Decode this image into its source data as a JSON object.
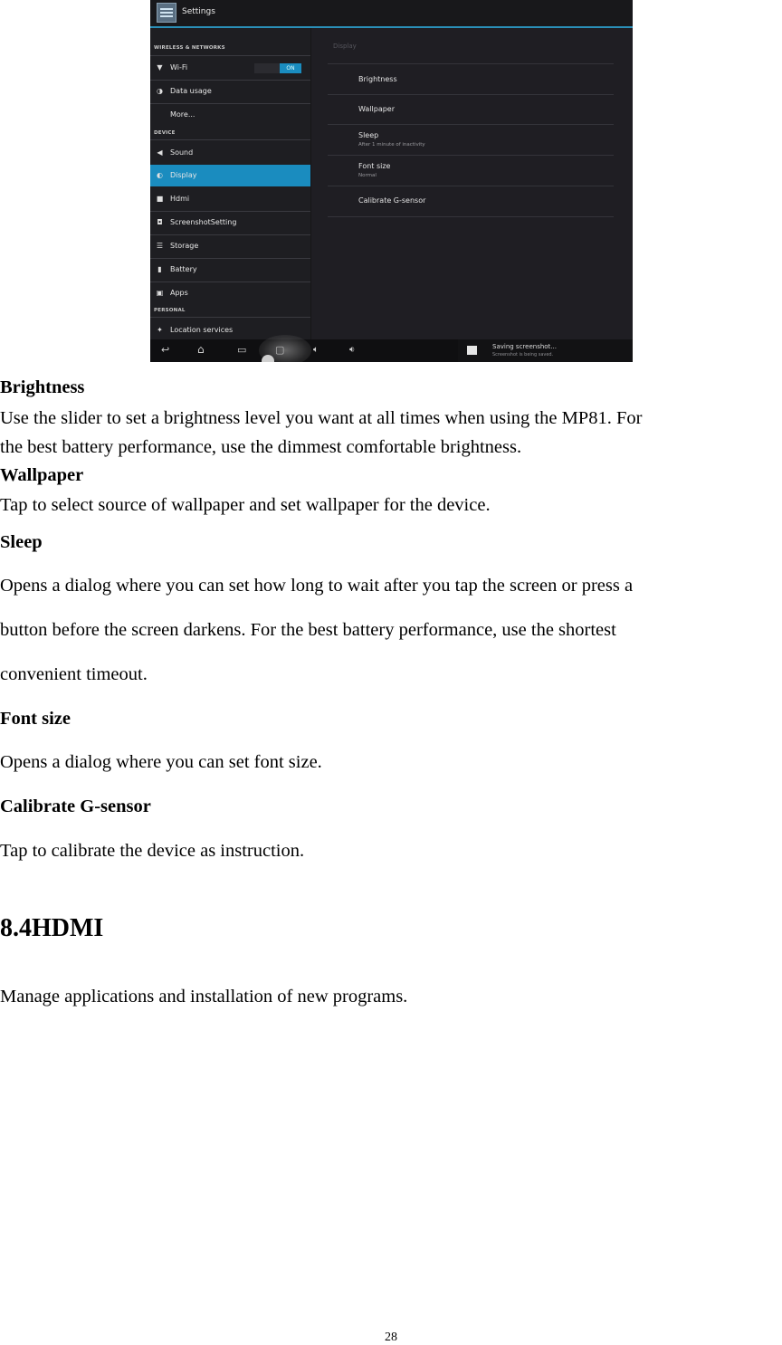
{
  "screenshot": {
    "title": "Settings",
    "sections": {
      "wireless": "WIRELESS & NETWORKS",
      "device": "DEVICE",
      "personal": "PERSONAL"
    },
    "left_items": [
      {
        "label": "Wi-Fi",
        "icon": "wifi-icon",
        "toggle": "ON"
      },
      {
        "label": "Data usage",
        "icon": "data-usage-icon"
      },
      {
        "label": "More...",
        "icon": ""
      },
      {
        "label": "Sound",
        "icon": "speaker-icon"
      },
      {
        "label": "Display",
        "icon": "display-icon",
        "selected": true
      },
      {
        "label": "Hdmi",
        "icon": "hdmi-icon"
      },
      {
        "label": "ScreenshotSetting",
        "icon": "camera-icon"
      },
      {
        "label": "Storage",
        "icon": "storage-icon"
      },
      {
        "label": "Battery",
        "icon": "battery-icon"
      },
      {
        "label": "Apps",
        "icon": "apps-icon"
      },
      {
        "label": "Location services",
        "icon": "location-icon"
      }
    ],
    "right": {
      "header": "Display",
      "items": [
        {
          "label": "Brightness"
        },
        {
          "label": "Wallpaper"
        },
        {
          "label": "Sleep",
          "sub": "After 1 minute of inactivity"
        },
        {
          "label": "Font size",
          "sub": "Normal"
        },
        {
          "label": "Calibrate G-sensor"
        }
      ]
    },
    "notification": {
      "title": "Saving screenshot...",
      "subtitle": "Screenshot is being saved."
    },
    "accent_color": "#1a8cbf"
  },
  "document": {
    "brightness_heading": "Brightness",
    "brightness_text_1": "Use the slider to set a brightness level you want at all times when using the MP81. For",
    "brightness_text_2": "the best battery performance, use the dimmest comfortable brightness.",
    "wallpaper_heading": "Wallpaper",
    "wallpaper_text": "Tap to select source of wallpaper and set wallpaper for the device.",
    "sleep_heading": "Sleep",
    "sleep_text_1": "Opens a dialog where you can set how long to wait after you tap the screen or press a",
    "sleep_text_2": "button before the screen darkens. For the best battery performance, use the shortest",
    "sleep_text_3": "convenient timeout.",
    "fontsize_heading": "Font size",
    "fontsize_text": "Opens a dialog where you can set font size.",
    "gsensor_heading": "Calibrate G-sensor",
    "gsensor_text": "Tap to calibrate the device as instruction.",
    "section_heading": "8.4HDMI",
    "section_text": "Manage applications and installation of new programs.",
    "page_number": "28"
  }
}
